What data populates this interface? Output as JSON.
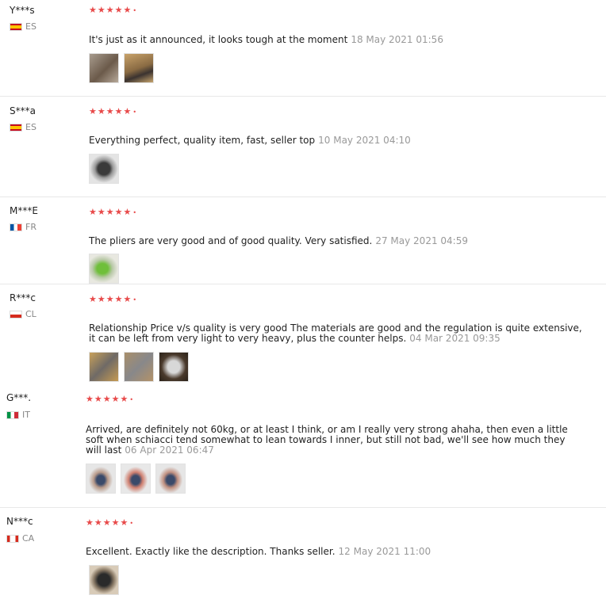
{
  "colors": {
    "star": "#e84a4a",
    "muted": "#999999",
    "divider": "#e8e8e8"
  },
  "reviews": [
    {
      "user": "Y***s",
      "country": "ES",
      "stars": "★★★★★",
      "text": "It's just as it announced, it looks tough at the moment",
      "time": "18 May 2021 01:56",
      "photos": 2
    },
    {
      "user": "S***a",
      "country": "ES",
      "stars": "★★★★★",
      "text": "Everything perfect, quality item, fast, seller top",
      "time": "10 May 2021 04:10",
      "photos": 1
    },
    {
      "user": "M***E",
      "country": "FR",
      "stars": "★★★★★",
      "text": "The pliers are very good and of good quality. Very satisfied.",
      "time": "27 May 2021 04:59",
      "photos": 1
    },
    {
      "user": "R***c",
      "country": "CL",
      "stars": "★★★★★",
      "text_l1": "Relationship Price v/s quality is very good The materials are good and the regulation is quite extensive,",
      "text_l2": "it can be left from very light to very heavy, plus the counter helps.",
      "time": "04 Mar 2021 09:35",
      "photos": 3
    },
    {
      "user": "G***.",
      "country": "IT",
      "stars": "★★★★★",
      "text_l1": "Arrived, are definitely not 60kg, or at least I think, or am I really very strong ahaha, then even a little",
      "text_l2": "soft when schiacci tend somewhat to lean towards I inner, but still not bad, we'll see how much they",
      "text_l3": "will last",
      "time": "06 Apr 2021 06:47",
      "photos": 3
    },
    {
      "user": "N***c",
      "country": "CA",
      "stars": "★★★★★",
      "text": "Excellent. Exactly like the description. Thanks seller.",
      "time": "12 May 2021 11:00",
      "photos": 1
    }
  ]
}
